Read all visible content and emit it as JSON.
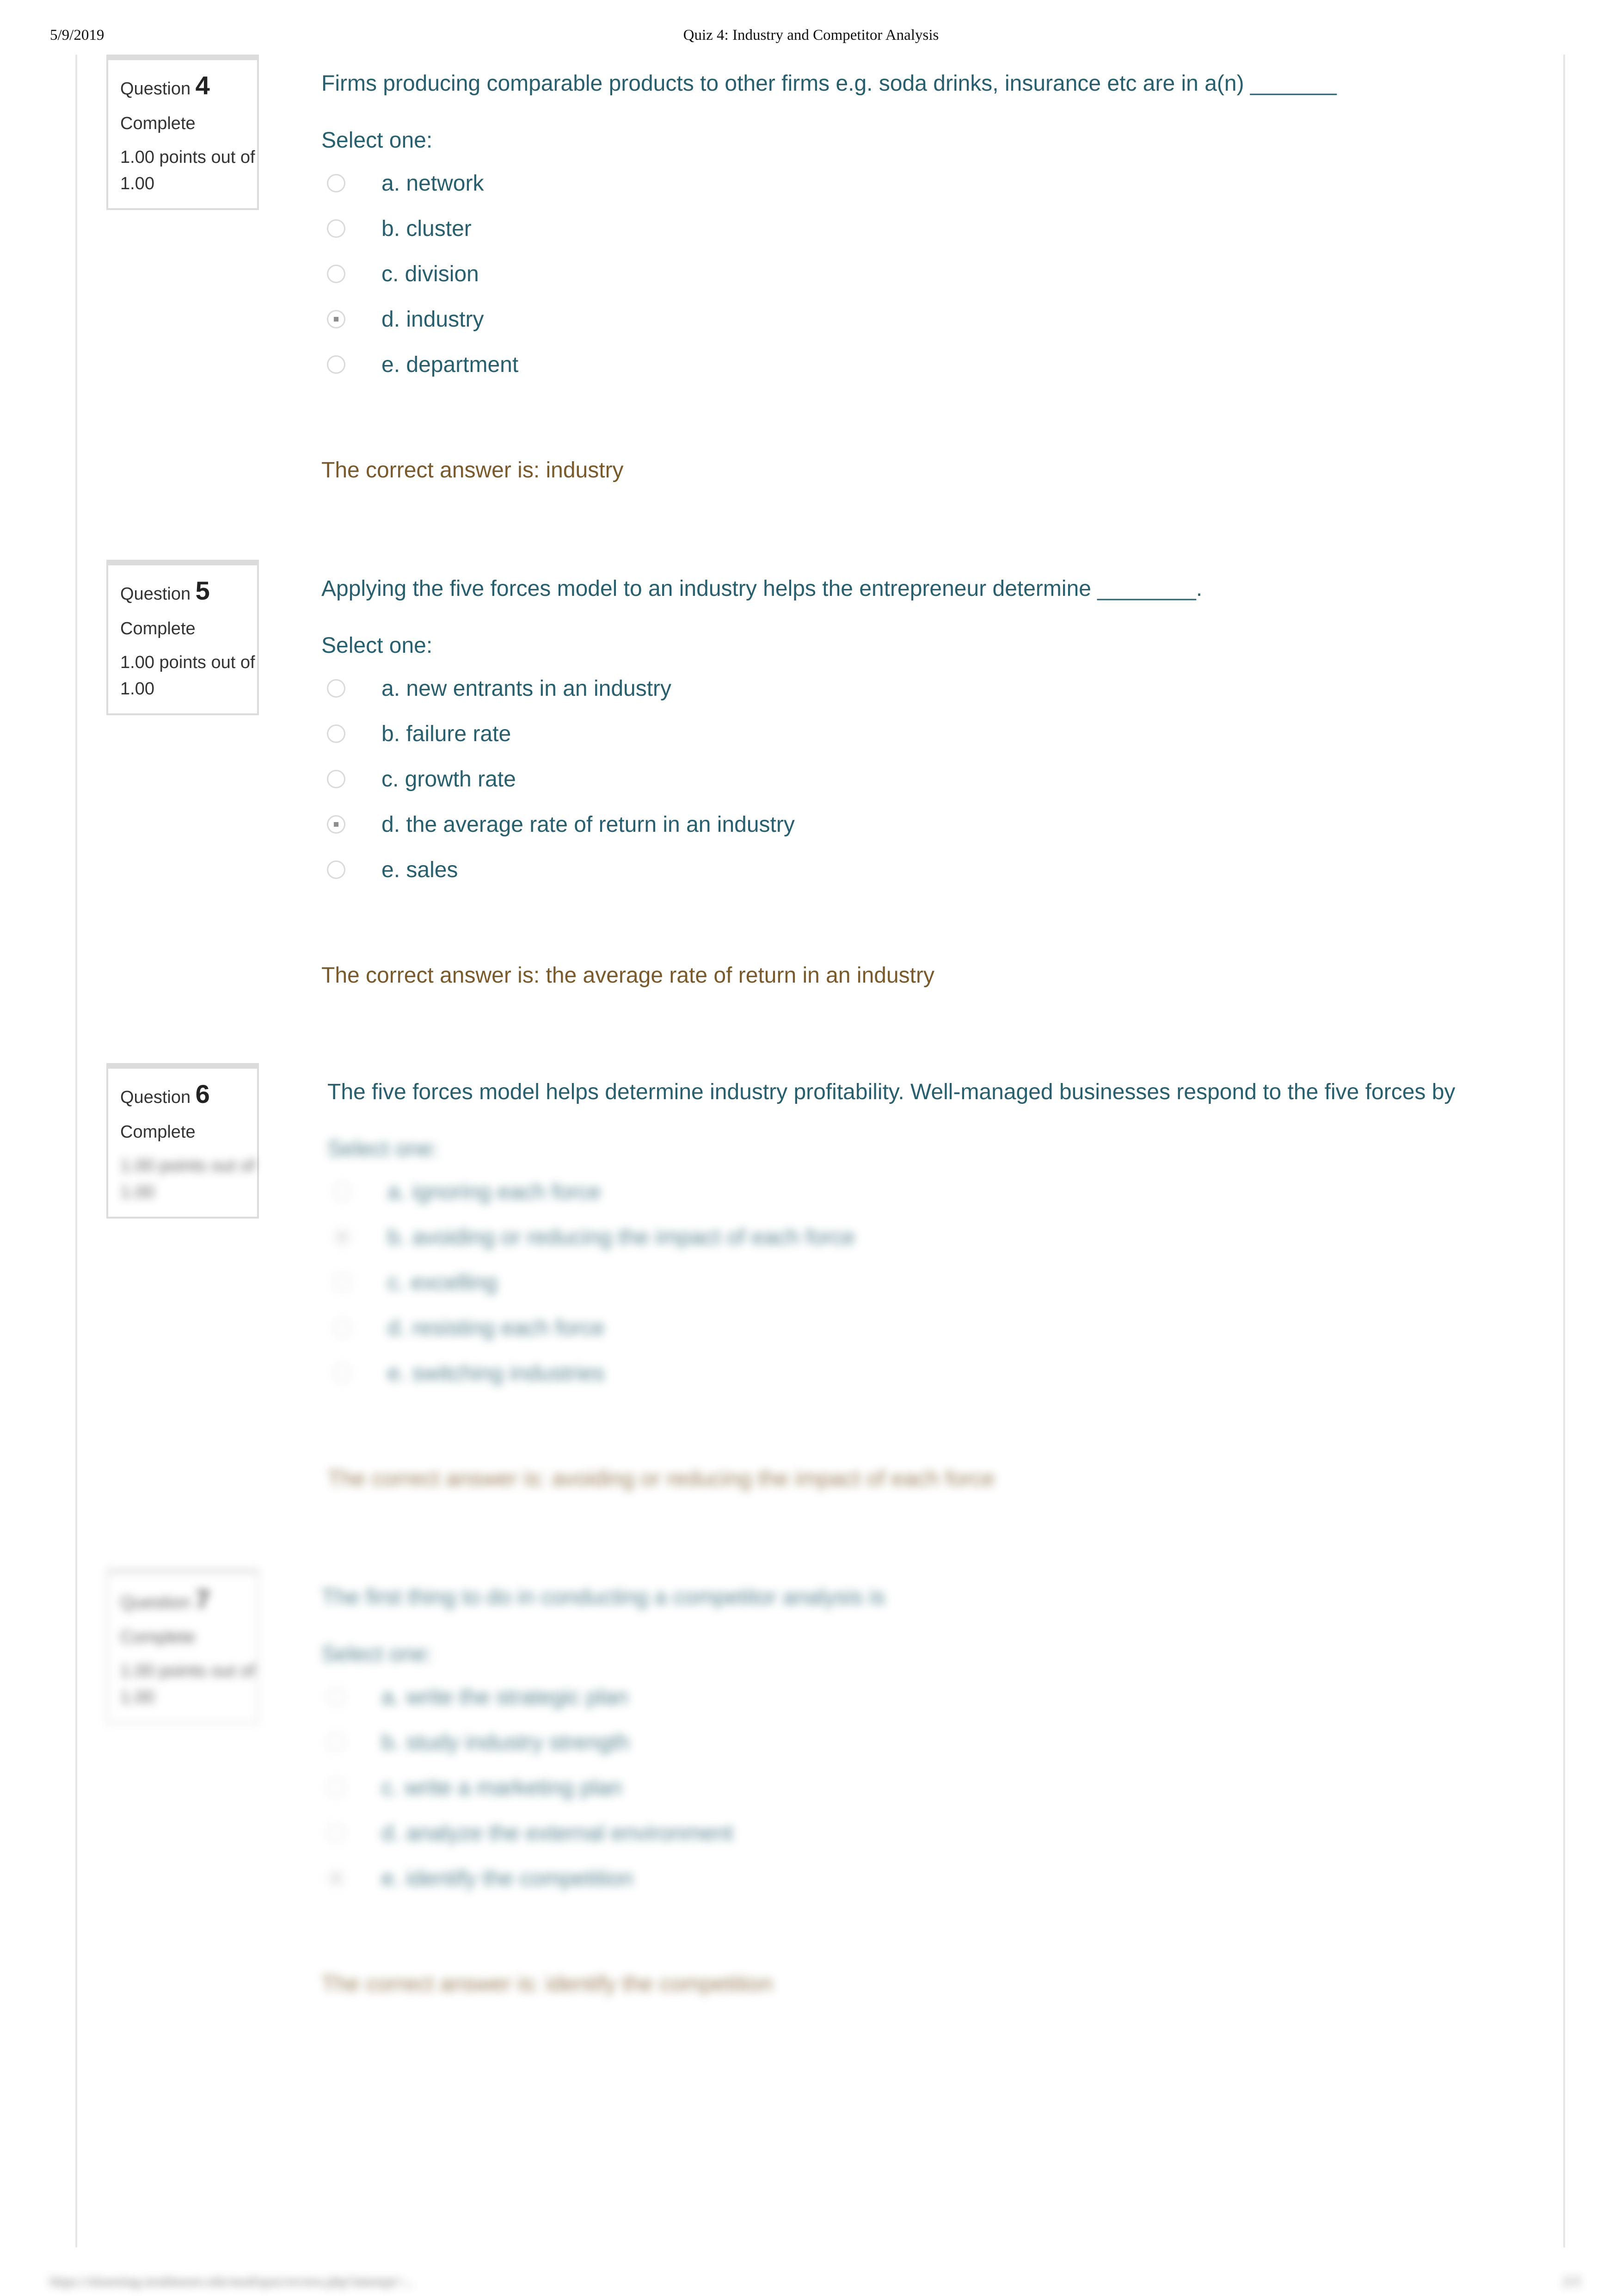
{
  "header": {
    "date": "5/9/2019",
    "title": "Quiz 4: Industry and Competitor Analysis"
  },
  "colors": {
    "question_text": "#275f6e",
    "correct_answer": "#7a5a2a",
    "info_text": "#333333",
    "box_border": "#dcdcdc"
  },
  "questions": [
    {
      "label": "Question",
      "number": "4",
      "state": "Complete",
      "grade": "1.00 points out of 1.00",
      "text": "Firms producing comparable products to other firms  e.g. soda drinks, insurance etc are in a(n) _______",
      "prompt": "Select one:",
      "options": [
        {
          "label": "a. network",
          "checked": false
        },
        {
          "label": "b. cluster",
          "checked": false
        },
        {
          "label": "c. division",
          "checked": false
        },
        {
          "label": "d. industry",
          "checked": true
        },
        {
          "label": "e. department",
          "checked": false
        }
      ],
      "right_answer": "The correct answer is: industry"
    },
    {
      "label": "Question",
      "number": "5",
      "state": "Complete",
      "grade": "1.00 points out of 1.00",
      "text": "Applying the five forces model to an industry helps the entrepreneur determine ________.",
      "prompt": "Select one:",
      "options": [
        {
          "label": "a. new entrants in an industry",
          "checked": false
        },
        {
          "label": "b. failure rate",
          "checked": false
        },
        {
          "label": "c. growth rate",
          "checked": false
        },
        {
          "label": "d. the average rate of return in an industry",
          "checked": true
        },
        {
          "label": "e. sales",
          "checked": false
        }
      ],
      "right_answer": "The correct answer is: the average rate of return in an industry"
    },
    {
      "label": "Question",
      "number": "6",
      "state": "Complete",
      "grade": "1.00 points out of 1.00",
      "text": " The five forces model helps determine industry profitability. Well-managed businesses respond to the five forces  by",
      "prompt": "Select one:",
      "options": [
        {
          "label": "a. ignoring each force",
          "checked": false
        },
        {
          "label": "b. avoiding or reducing the impact of each force",
          "checked": true
        },
        {
          "label": "c. excelling",
          "checked": false
        },
        {
          "label": "d. resisting each force",
          "checked": false
        },
        {
          "label": "e. switching industries",
          "checked": false
        }
      ],
      "right_answer": "The correct answer is: avoiding or reducing the impact of each force"
    },
    {
      "label": "Question",
      "number": "7",
      "state": "Complete",
      "grade": "1.00 points out of 1.00",
      "text": "The first thing to do in conducting a competitor analysis is",
      "prompt": "Select one:",
      "options": [
        {
          "label": "a. write the strategic plan",
          "checked": false
        },
        {
          "label": "b. study industry strength",
          "checked": false
        },
        {
          "label": "c. write a marketing plan",
          "checked": false
        },
        {
          "label": "d. analyze the external environment",
          "checked": false
        },
        {
          "label": "e. identify the competition",
          "checked": true
        }
      ],
      "right_answer": "The correct answer is: identify the competition"
    }
  ],
  "footer": {
    "url": "https://elearning.strathmore.edu/mod/quiz/review.php?attempt=...",
    "page": "2/3"
  }
}
